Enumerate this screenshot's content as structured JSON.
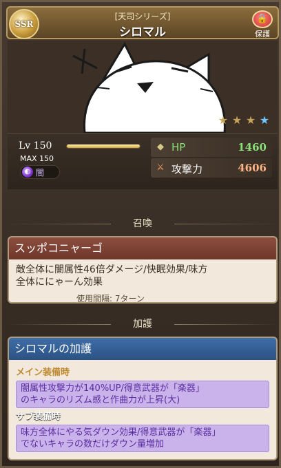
{
  "header": {
    "rarity": "SSR",
    "series": "[天司シリーズ]",
    "name": "シロマル",
    "lock_label": "保護"
  },
  "stars": {
    "filled": 3,
    "total": 4
  },
  "stats": {
    "lv_label": "Lv 150",
    "lv_progress": 1.0,
    "max_label": "MAX 150",
    "element_label": "闇",
    "hp_label": "HP",
    "hp_value": "1460",
    "atk_label": "攻撃力",
    "atk_value": "4606"
  },
  "summon": {
    "section_title": "召喚",
    "name": "スッポコニャーゴ",
    "effect_line1": "敵全体に闇属性46倍ダメージ/快眠効果/味方",
    "effect_line2": "全体ににゃーん効果",
    "turn_text": "使用間隔: 7ターン"
  },
  "boost": {
    "section_title": "加護",
    "name": "シロマルの加護",
    "main_title": "メイン装備時",
    "main_line1": "闇属性攻撃力が140%UP/得意武器が「楽器」",
    "main_line2": "のキャラのリズム感と作曲力が上昇(大)",
    "sub_title": "サブ装備時",
    "sub_line1": "味方全体にやる気ダウン効果/得意武器が「楽器」",
    "sub_line2": "でないキャラの数だけダウン量増加"
  },
  "colors": {
    "hp_value": "#8be07a",
    "atk_value": "#ffb487",
    "hp_label": "#8be07a"
  }
}
